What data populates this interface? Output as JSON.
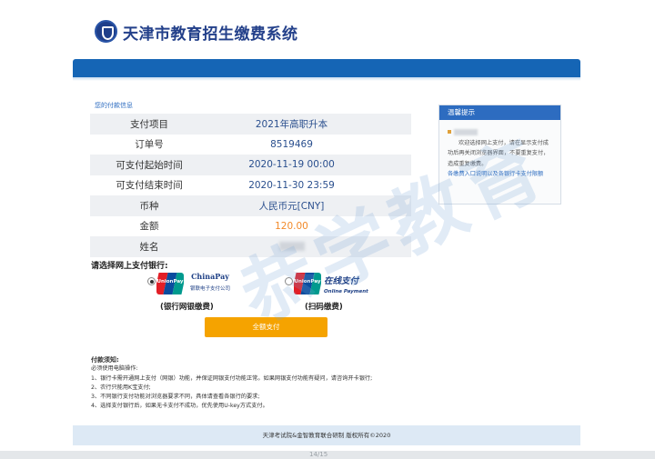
{
  "header": {
    "system_title": "天津市教育招生缴费系统"
  },
  "payment_info": {
    "section_title": "您的付款信息",
    "rows": [
      {
        "label": "支付项目",
        "value": "2021年高职升本"
      },
      {
        "label": "订单号",
        "value": "8519469"
      },
      {
        "label": "可支付起始时间",
        "value": "2020-11-19 00:00"
      },
      {
        "label": "可支付结束时间",
        "value": "2020-11-30 23:59"
      },
      {
        "label": "币种",
        "value": "人民币元[CNY]"
      },
      {
        "label": "金额",
        "value": "120.00"
      },
      {
        "label": "姓名",
        "value": ""
      }
    ]
  },
  "tip": {
    "title": "温馨提示",
    "line1": "欢迎选择网上支付，请在显示支付成功后再关闭浏览器界面，不要重复支付，造成重复缴费。",
    "link": "各缴费入口说明以及各银行卡支付限额"
  },
  "bank_select": {
    "title": "请选择网上支付银行:",
    "unionpay_text": "UnionPay",
    "option1": {
      "brand": "ChinaPay",
      "sub": "银联电子支付公司",
      "caption": "(银行网银缴费)",
      "selected": true
    },
    "option2": {
      "brand": "在线支付",
      "sub": "Online Payment",
      "caption": "(扫码缴费)",
      "selected": false
    }
  },
  "pay_button": {
    "label": "全额支付"
  },
  "notes": {
    "title": "付款须知:",
    "lines": [
      "必须使用电脑操作:",
      "1、银行卡需开通网上支付（网银）功能，并保证网银支付功能正常。如果网银支付功能有疑问，请咨询开卡银行;",
      "2、农行只能用K宝支付;",
      "3、不同银行支付功能对浏览器要求不同，具体请查看各银行的要求;",
      "4、选择支付银行后，如果无卡支付不成功，优先使用U-key方式支付。"
    ]
  },
  "footer": {
    "text": "天津考试院&金智教育联合研制    版权所有©2020"
  },
  "watermark": {
    "text": "恭学教育"
  },
  "page_number": "14/15",
  "colors": {
    "nav_blue": "#1565b5",
    "accent_orange": "#f5a300",
    "amount_orange": "#f28a2a",
    "title_blue": "#23408a"
  }
}
